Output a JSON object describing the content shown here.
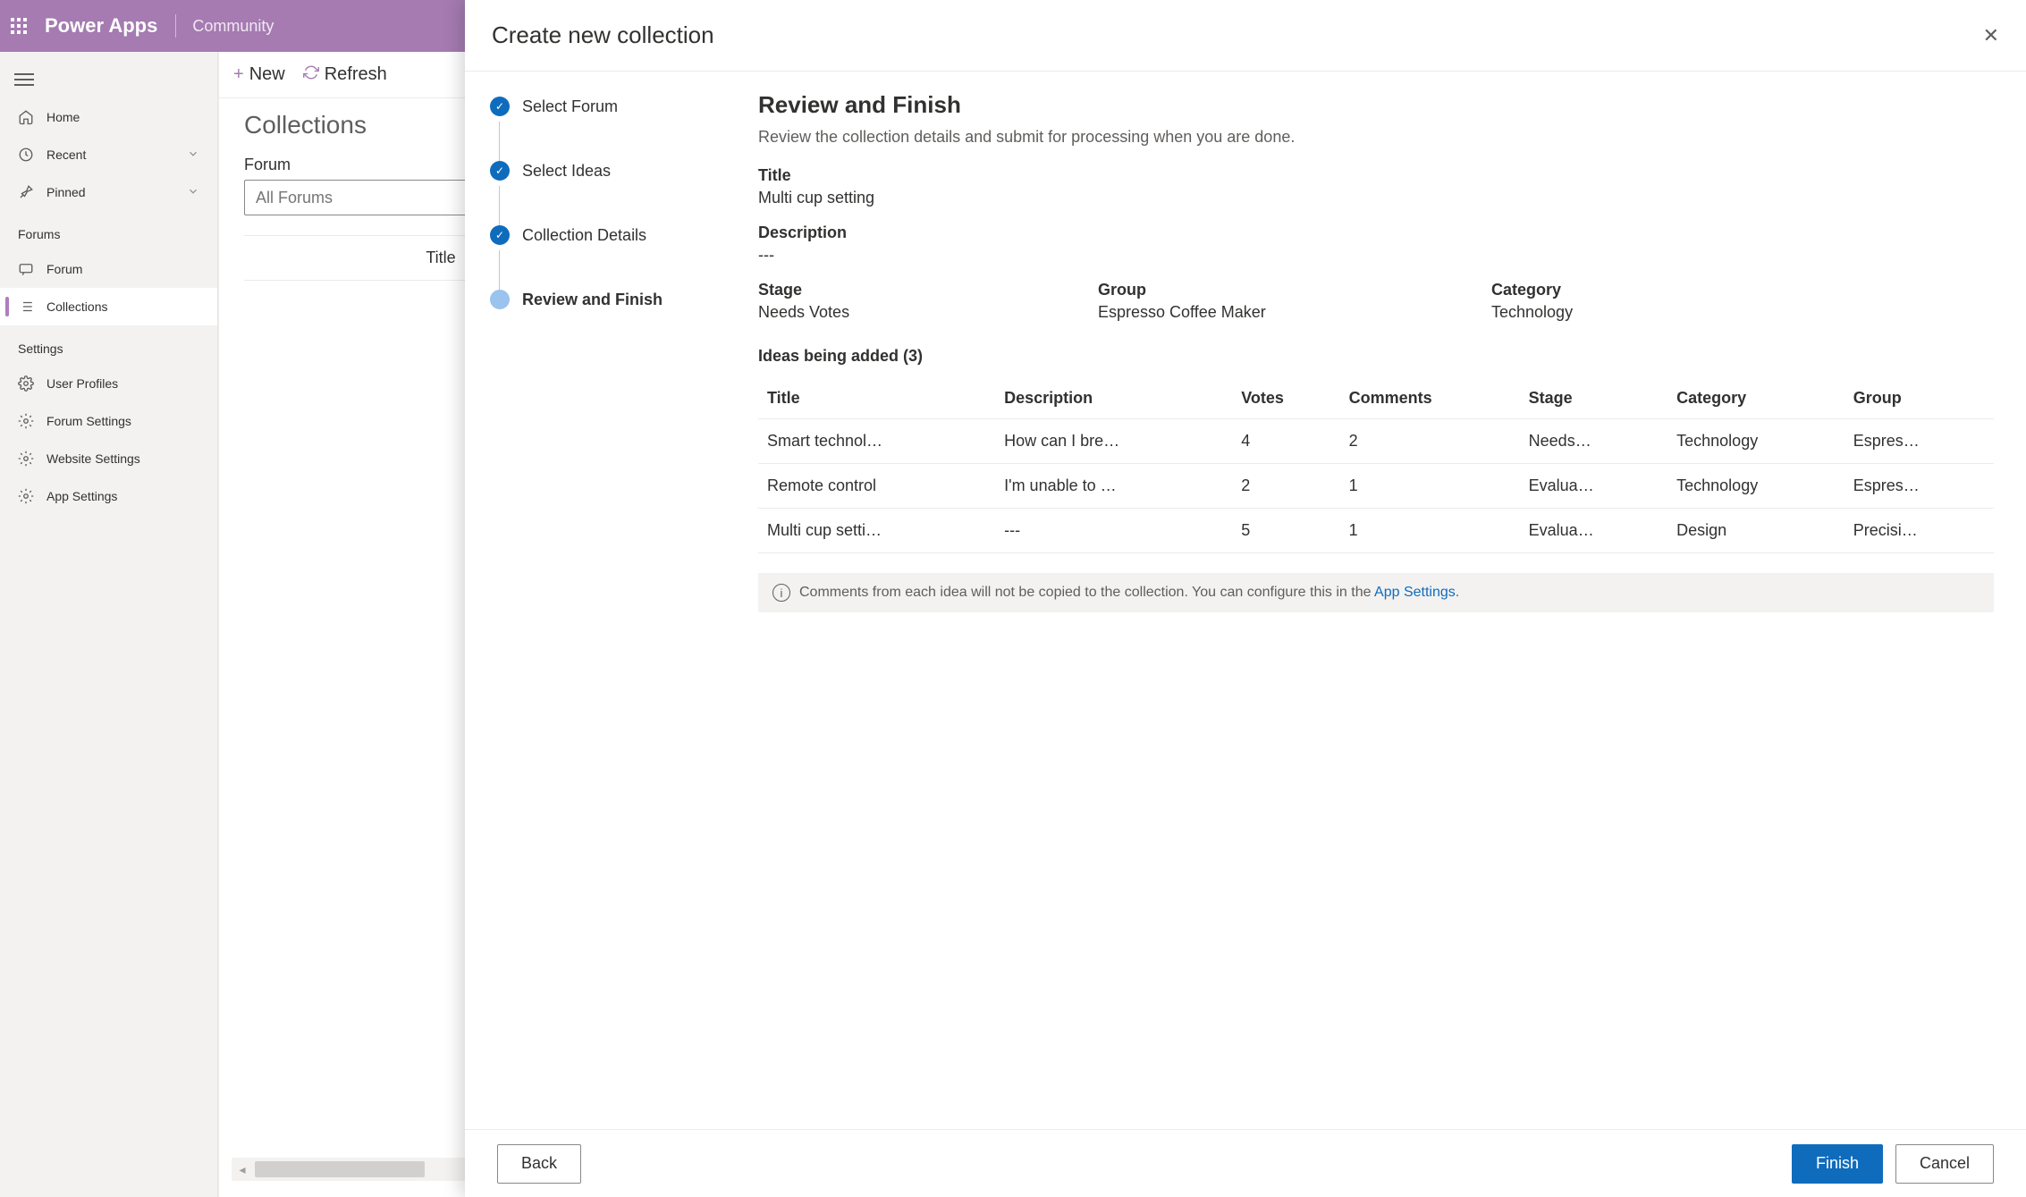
{
  "header": {
    "appName": "Power Apps",
    "sub": "Community"
  },
  "nav": {
    "items": [
      {
        "icon": "home",
        "label": "Home"
      },
      {
        "icon": "clock",
        "label": "Recent",
        "chevron": true
      },
      {
        "icon": "pin",
        "label": "Pinned",
        "chevron": true
      }
    ],
    "group1Label": "Forums",
    "group1": [
      {
        "icon": "chat",
        "label": "Forum"
      },
      {
        "icon": "list",
        "label": "Collections",
        "active": true
      }
    ],
    "group2Label": "Settings",
    "group2": [
      {
        "icon": "gear",
        "label": "User Profiles"
      },
      {
        "icon": "gear",
        "label": "Forum Settings"
      },
      {
        "icon": "gear",
        "label": "Website Settings"
      },
      {
        "icon": "gear",
        "label": "App Settings"
      }
    ]
  },
  "mid": {
    "newLabel": "New",
    "refreshLabel": "Refresh",
    "pageTitle": "Collections",
    "forumLabel": "Forum",
    "forumPlaceholder": "All Forums",
    "tableHeader": "Title"
  },
  "modal": {
    "title": "Create new collection",
    "steps": [
      {
        "label": "Select Forum",
        "state": "done"
      },
      {
        "label": "Select Ideas",
        "state": "done"
      },
      {
        "label": "Collection Details",
        "state": "done"
      },
      {
        "label": "Review and Finish",
        "state": "current"
      }
    ],
    "review": {
      "heading": "Review and Finish",
      "sub": "Review the collection details and submit for processing when you are done.",
      "titleLabel": "Title",
      "titleVal": "Multi cup setting",
      "descLabel": "Description",
      "descVal": "---",
      "stageLabel": "Stage",
      "stageVal": "Needs Votes",
      "groupLabel": "Group",
      "groupVal": "Espresso Coffee Maker",
      "catLabel": "Category",
      "catVal": "Technology",
      "ideasLabel": "Ideas being added (3)",
      "columns": [
        "Title",
        "Description",
        "Votes",
        "Comments",
        "Stage",
        "Category",
        "Group"
      ],
      "rows": [
        {
          "title": "Smart technol…",
          "desc": "How can I bre…",
          "votes": "4",
          "comments": "2",
          "stage": "Needs…",
          "category": "Technology",
          "group": "Espres…"
        },
        {
          "title": "Remote control",
          "desc": "I'm unable to …",
          "votes": "2",
          "comments": "1",
          "stage": "Evalua…",
          "category": "Technology",
          "group": "Espres…"
        },
        {
          "title": "Multi cup setti…",
          "desc": "---",
          "votes": "5",
          "comments": "1",
          "stage": "Evalua…",
          "category": "Design",
          "group": "Precisi…"
        }
      ],
      "infoText": "Comments from each idea will not be copied to the collection. You can configure this in the ",
      "infoLink": "App Settings"
    },
    "backLabel": "Back",
    "finishLabel": "Finish",
    "cancelLabel": "Cancel"
  }
}
